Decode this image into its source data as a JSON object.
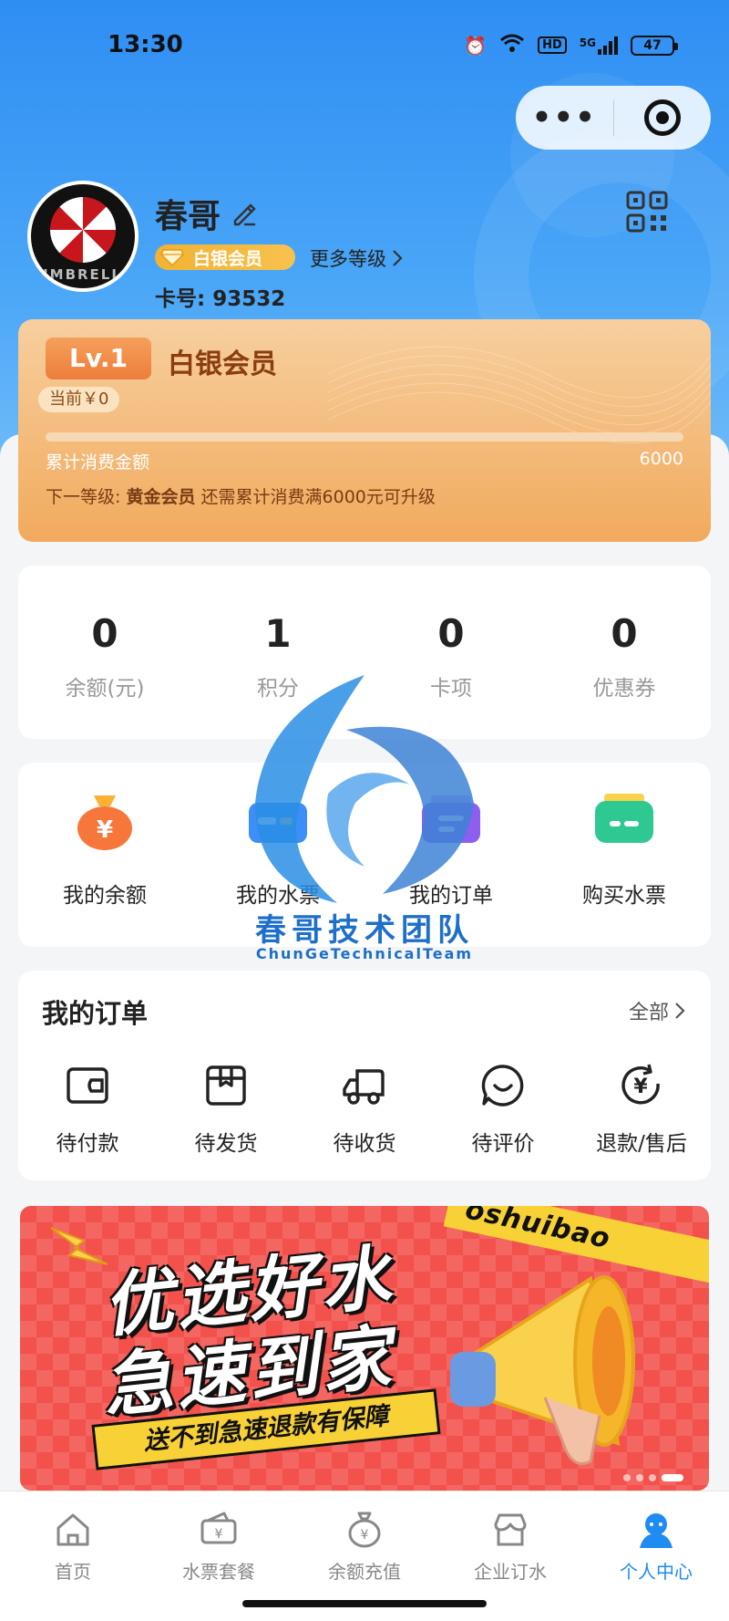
{
  "status_bar": {
    "time": "13:30",
    "network": "5G",
    "hd": "HD",
    "battery": "47"
  },
  "capsule": {
    "more_glyph": "•••"
  },
  "profile": {
    "name": "春哥",
    "member_badge": "白银会员",
    "more_levels": "更多等级",
    "card_label": "卡号:",
    "card_number": "93532",
    "avatar_text": "UMBRELLA"
  },
  "level_card": {
    "level": "Lv.1",
    "level_name": "白银会员",
    "current": "当前￥0",
    "progress_fraction": 0,
    "accumulated_label": "累计消费金额",
    "max_value": "6000",
    "next_prefix": "下一等级:",
    "next_level": "黄金会员",
    "next_hint": "还需累计消费满6000元可升级"
  },
  "stats": [
    {
      "value": "0",
      "label": "余额(元)"
    },
    {
      "value": "1",
      "label": "积分"
    },
    {
      "value": "0",
      "label": "卡项"
    },
    {
      "value": "0",
      "label": "优惠券"
    }
  ],
  "quick_actions": [
    {
      "label": "我的余额",
      "icon": "money-bag-icon"
    },
    {
      "label": "我的水票",
      "icon": "ticket-card-icon"
    },
    {
      "label": "我的订单",
      "icon": "order-card-icon"
    },
    {
      "label": "购买水票",
      "icon": "buy-ticket-icon"
    }
  ],
  "orders": {
    "title": "我的订单",
    "all": "全部",
    "items": [
      {
        "label": "待付款",
        "icon": "wallet-icon"
      },
      {
        "label": "待发货",
        "icon": "package-icon"
      },
      {
        "label": "待收货",
        "icon": "truck-icon"
      },
      {
        "label": "待评价",
        "icon": "chat-smile-icon"
      },
      {
        "label": "退款/售后",
        "icon": "refund-icon"
      }
    ]
  },
  "banner": {
    "line1": "优选好水",
    "line2": "急速到家",
    "strip": "送不到急速退款有保障",
    "tape": "oshuibao"
  },
  "watermark": {
    "title": "春哥技术团队",
    "subtitle": "ChunGeTechnicalTeam"
  },
  "tabbar": [
    {
      "label": "首页",
      "icon": "home-icon",
      "active": false
    },
    {
      "label": "水票套餐",
      "icon": "ticket-icon",
      "active": false
    },
    {
      "label": "余额充值",
      "icon": "money-bag-icon",
      "active": false
    },
    {
      "label": "企业订水",
      "icon": "store-icon",
      "active": false
    },
    {
      "label": "个人中心",
      "icon": "person-icon",
      "active": true
    }
  ],
  "colors": {
    "accent": "#1e8cf1",
    "hero": "#2f8ef3",
    "gold": "#f3b233",
    "banner": "#f2514c"
  }
}
